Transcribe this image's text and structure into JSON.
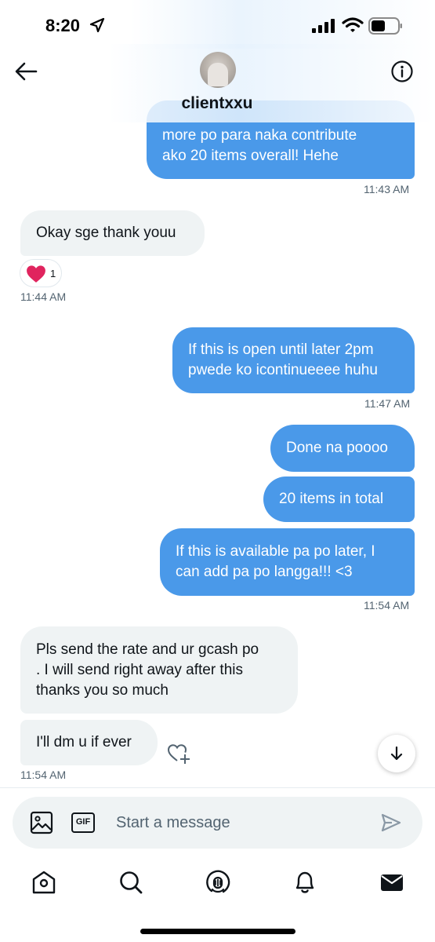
{
  "status_bar": {
    "time": "8:20"
  },
  "header": {
    "username": "clientxxu",
    "icons": {
      "back": "arrow-left-icon",
      "info": "info-icon"
    }
  },
  "messages": {
    "m1": {
      "lines": [
        "more po para naka contribute",
        "ako 20 items overall! Hehe"
      ],
      "direction": "outgoing"
    },
    "m1_time": "11:43 AM",
    "m2": {
      "lines": [
        "Okay sge thank youu"
      ],
      "direction": "incoming"
    },
    "m2_reaction": {
      "icon": "heart-icon",
      "count": "1",
      "color": "#e0245e"
    },
    "m2_time": "11:44 AM",
    "m3": {
      "lines": [
        "If this is open until later 2pm",
        "pwede ko icontinueeee huhu"
      ],
      "direction": "outgoing"
    },
    "m3_time": "11:47 AM",
    "m4": {
      "lines": [
        "Done na poooo"
      ],
      "direction": "outgoing"
    },
    "m5": {
      "lines": [
        "20 items in total"
      ],
      "direction": "outgoing"
    },
    "m6": {
      "lines": [
        "If this is available pa po later, I",
        "can add pa po langga!!! <3"
      ],
      "direction": "outgoing"
    },
    "m6_time": "11:54 AM",
    "m7": {
      "lines": [
        "Pls send the rate and ur gcash po",
        ". I will send right away after this",
        "thanks you so much"
      ],
      "direction": "incoming"
    },
    "m8": {
      "lines": [
        "I'll dm u if ever"
      ],
      "direction": "incoming"
    },
    "m8_time": "11:54 AM"
  },
  "composer": {
    "placeholder": "Start a message",
    "gif_label": "GIF",
    "icons": {
      "media": "image-icon",
      "gif": "gif-icon",
      "send": "send-icon"
    }
  },
  "nav": {
    "items": [
      "home-icon",
      "search-icon",
      "spaces-icon",
      "notifications-icon",
      "messages-icon"
    ]
  },
  "colors": {
    "outgoing_bubble": "#4a99e9",
    "incoming_bubble": "#eff3f4",
    "timestamp": "#536471"
  }
}
